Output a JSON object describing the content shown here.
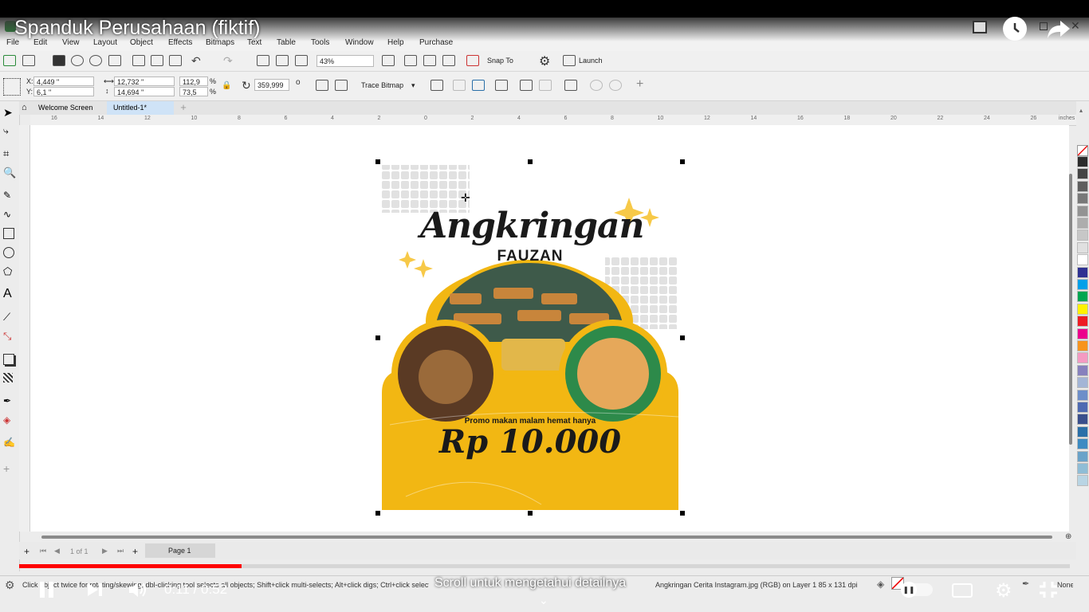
{
  "video": {
    "title": "Spanduk Perusahaan (fiktif)",
    "time_current": "0:11",
    "time_separator": "/",
    "time_total": "0:52",
    "progress_fraction": 0.212,
    "scroll_hint": "Scroll untuk mengetahui detailnya"
  },
  "menu": [
    "File",
    "Edit",
    "View",
    "Layout",
    "Object",
    "Effects",
    "Bitmaps",
    "Text",
    "Table",
    "Tools",
    "Window",
    "Help",
    "Purchase"
  ],
  "toolbar": {
    "zoom": "43%",
    "snap_to": "Snap To",
    "launch": "Launch"
  },
  "propbar": {
    "x": "4,449 \"",
    "y": "6,1 \"",
    "width": "12,732 \"",
    "height": "14,694 \"",
    "scale_w": "112,9",
    "scale_h": "73,5",
    "pct_w": "%",
    "pct_h": "%",
    "rotation": "359,999",
    "trace_bitmap": "Trace Bitmap"
  },
  "tabs": {
    "welcome": "Welcome Screen",
    "doc": "Untitled-1*"
  },
  "ruler": {
    "unit": "inches",
    "labels": [
      "16",
      "14",
      "12",
      "10",
      "8",
      "6",
      "4",
      "2",
      "0",
      "2",
      "4",
      "6",
      "8",
      "10",
      "12",
      "14",
      "16",
      "18",
      "20",
      "22",
      "24",
      "26"
    ]
  },
  "pagebar": {
    "page_count": "1 of 1",
    "page_tab": "Page 1"
  },
  "status": {
    "left": "Click object twice for rotating/skewing; dbl-clicking tool selects all objects; Shift+click multi-selects; Alt+click digs; Ctrl+click selects in a group",
    "right": "Angkringan Cerita Instagram.jpg (RGB) on Layer 1  85 x 131 dpi",
    "none": "None"
  },
  "poster": {
    "headline": "Angkringan",
    "subhead": "FAUZAN",
    "promo": "Promo makan malam hemat hanya",
    "price": "Rp 10.000"
  },
  "colors": {
    "poster_yellow": "#f2b713",
    "accent_red": "#e8141b",
    "palette": [
      "#2b2b2b",
      "#444444",
      "#5e5e5e",
      "#787878",
      "#939393",
      "#adadad",
      "#c7c7c7",
      "#e0e0e0",
      "#ffffff",
      "#2e3192",
      "#00a0e9",
      "#00a651",
      "#fff200",
      "#ed1c24",
      "#ec008c",
      "#f7941d",
      "#f49ac2",
      "#8781bd",
      "#a3b5d6",
      "#6d8ec9",
      "#4e6ab2",
      "#3a4f8c",
      "#2a6fa8",
      "#3d8bc2",
      "#6aa3c9",
      "#8fbdd6",
      "#b9d5e4"
    ]
  }
}
